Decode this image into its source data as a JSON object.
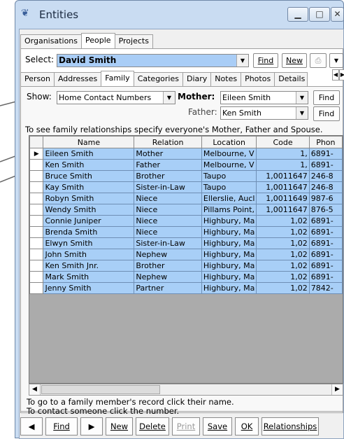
{
  "window": {
    "title": "Entities",
    "min_glyph": "▁",
    "max_glyph": "□",
    "close_glyph": "✕"
  },
  "top_tabs": [
    "Organisations",
    "People",
    "Projects"
  ],
  "select": {
    "label": "Select:",
    "value": "David Smith",
    "find": "Find",
    "new": "New"
  },
  "inner_tabs": [
    "Person",
    "Addresses",
    "Family",
    "Categories",
    "Diary",
    "Notes",
    "Photos",
    "Details"
  ],
  "show": {
    "label": "Show:",
    "value": "Home Contact Numbers"
  },
  "mother": {
    "label": "Mother:",
    "value": "Eileen Smith",
    "find": "Find"
  },
  "father": {
    "label": "Father:",
    "value": "Ken Smith",
    "find": "Find"
  },
  "instructions": "To see family relationships specify everyone's Mother, Father and Spouse.",
  "grid": {
    "columns": [
      "",
      "Name",
      "Relation",
      "Location",
      "Code",
      "Phon"
    ],
    "rows": [
      {
        "sel": "▶",
        "name": "Eileen Smith",
        "relation": "Mother",
        "location": "Melbourne, V",
        "code": "1,",
        "phone": "6891-"
      },
      {
        "sel": "",
        "name": "Ken Smith",
        "relation": "Father",
        "location": "Melbourne, V",
        "code": "1,",
        "phone": "6891-"
      },
      {
        "sel": "",
        "name": "Bruce Smith",
        "relation": "Brother",
        "location": "Taupo",
        "code": "1,0011647",
        "phone": "246-8"
      },
      {
        "sel": "",
        "name": "Kay Smith",
        "relation": "Sister-in-Law",
        "location": "Taupo",
        "code": "1,0011647",
        "phone": "246-8"
      },
      {
        "sel": "",
        "name": "Robyn Smith",
        "relation": "Niece",
        "location": "Ellerslie, Aucl",
        "code": "1,0011649",
        "phone": "987-6"
      },
      {
        "sel": "",
        "name": "Wendy Smith",
        "relation": "Niece",
        "location": "Pillams Point,",
        "code": "1,0011647",
        "phone": "876-5"
      },
      {
        "sel": "",
        "name": "Connie Juniper",
        "relation": "Niece",
        "location": "Highbury, Ma",
        "code": "1,02",
        "phone": "6891-"
      },
      {
        "sel": "",
        "name": "Brenda Smith",
        "relation": "Niece",
        "location": "Highbury, Ma",
        "code": "1,02",
        "phone": "6891-"
      },
      {
        "sel": "",
        "name": "Elwyn Smith",
        "relation": "Sister-in-Law",
        "location": "Highbury, Ma",
        "code": "1,02",
        "phone": "6891-"
      },
      {
        "sel": "",
        "name": "John Smith",
        "relation": "Nephew",
        "location": "Highbury, Ma",
        "code": "1,02",
        "phone": "6891-"
      },
      {
        "sel": "",
        "name": "Ken Smith Jnr.",
        "relation": "Brother",
        "location": "Highbury, Ma",
        "code": "1,02",
        "phone": "6891-"
      },
      {
        "sel": "",
        "name": "Mark Smith",
        "relation": "Nephew",
        "location": "Highbury, Ma",
        "code": "1,02",
        "phone": "6891-"
      },
      {
        "sel": "",
        "name": "Jenny Smith",
        "relation": "Partner",
        "location": "Highbury, Ma",
        "code": "1,02",
        "phone": "7842-"
      }
    ]
  },
  "help": {
    "line1": "To go to a family member's record click their name.",
    "line2": "To contact someone click the number."
  },
  "bottom": {
    "prev": "◀",
    "find": "Find",
    "next": "▶",
    "new": "New",
    "delete": "Delete",
    "print": "Print",
    "save": "Save",
    "ok": "OK",
    "relationships": "Relationships"
  }
}
